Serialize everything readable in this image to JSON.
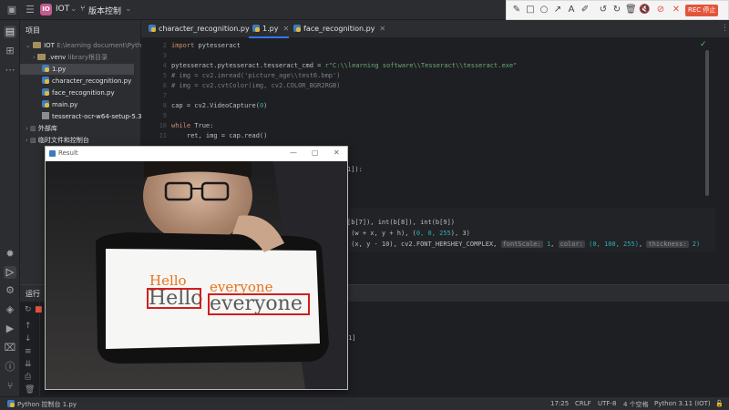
{
  "titlebar": {
    "project_badge": "IO",
    "project_name": "IOT",
    "vcs": "版本控制"
  },
  "recorder": {
    "stop_label": "REC 停止"
  },
  "project_panel": {
    "header": "项目",
    "rows": [
      {
        "prefix": "IOT",
        "dim": "E:\\learning document\\Pytho"
      },
      {
        "prefix": ".venv",
        "dim": "library根目录"
      },
      {
        "prefix": "1.py",
        "dim": ""
      },
      {
        "prefix": "character_recognition.py",
        "dim": ""
      },
      {
        "prefix": "face_recognition.py",
        "dim": ""
      },
      {
        "prefix": "main.py",
        "dim": ""
      },
      {
        "prefix": "tesseract-ocr-w64-setup-5.3",
        "dim": ""
      },
      {
        "prefix": "外部库",
        "dim": ""
      },
      {
        "prefix": "临时文件和控制台",
        "dim": ""
      }
    ]
  },
  "tabs": [
    {
      "label": "character_recognition.py"
    },
    {
      "label": "1.py"
    },
    {
      "label": "face_recognition.py"
    }
  ],
  "editor": {
    "line_numbers": [
      "2",
      "3",
      "4",
      "5",
      "6",
      "7",
      "8",
      "9",
      "10",
      "11"
    ],
    "code": {
      "l2_kw": "import",
      "l2_rest": " pytesseract",
      "l4_a": "pytesseract.pytesseract.tesseract_cmd = ",
      "l4_str": "r\"C:\\\\learning software\\\\Tesseract\\\\tesseract.exe\"",
      "l5": "# img = cv2.imread('picture_age\\\\test6.bmp')",
      "l6": "# img = cv2.cvtColor(img, cv2.COLOR_BGR2RGB)",
      "l8_a": "cap = cv2.VideoCapture(",
      "l8_num": "0",
      "l8_b": ")",
      "l10_kw": "while",
      "l10_b": " True:",
      "l11": "    ret, img = cap.read()",
      "frag1": "1]):",
      "frag2": "[b[7]), int(b[8]), int(b[9])",
      "frag3_a": " (w + x, y + h), (",
      "frag3_n": "0, 0, 255",
      "frag3_b": "), 3)",
      "frag4_a": " (x, y - 10), cv2.FONT_HERSHEY_COMPLEX, ",
      "hint_fontscale": "fontScale:",
      "fontscale_val": "1",
      "hint_color": "color:",
      "color_val": "(0, 100, 255)",
      "hint_thickness": "thickness:",
      "thickness_val": "2)",
      "frag5": "1]"
    }
  },
  "run_panel": {
    "label": "运行"
  },
  "camera_window": {
    "title": "Result",
    "detections": [
      {
        "text": "Hello",
        "color": "#e8731a"
      },
      {
        "text": "everyone",
        "color": "#e8731a"
      }
    ],
    "box_color": "#d11e1e"
  },
  "statusbar": {
    "breadcrumb": "Python 控制台 1.py",
    "position": "17:25",
    "line_sep": "CRLF",
    "encoding": "UTF-8",
    "indent": "4 个空格",
    "interpreter": "Python 3.11 (IOT)"
  }
}
